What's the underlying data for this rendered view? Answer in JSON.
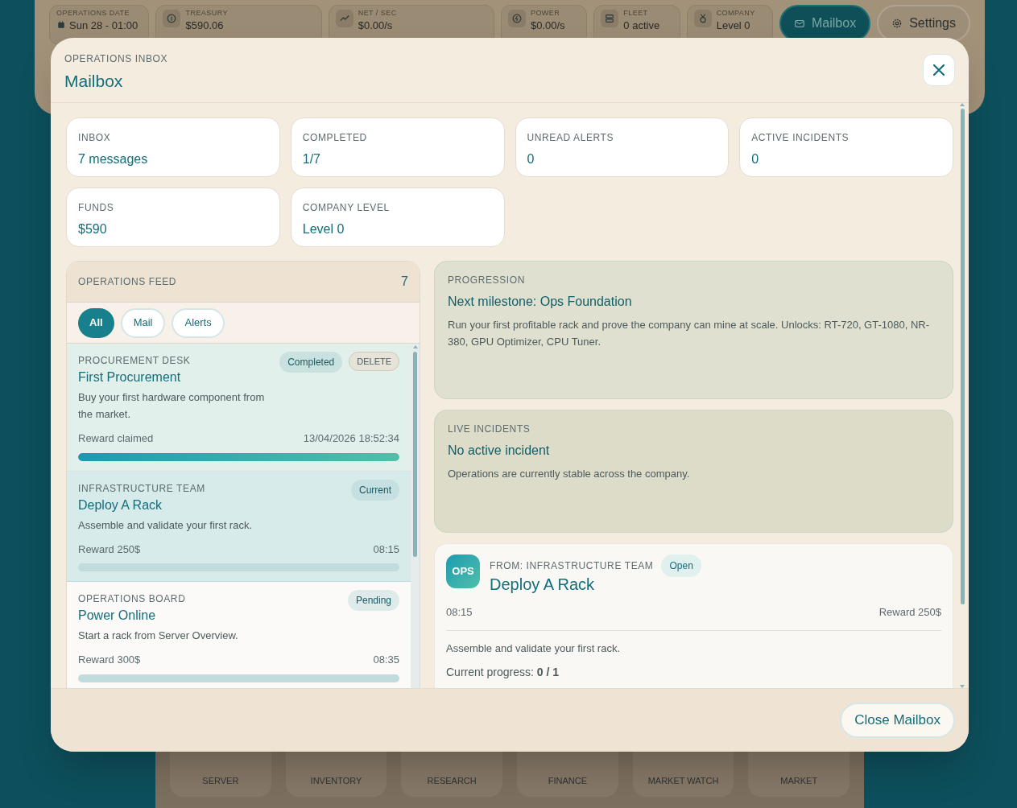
{
  "topbar": {
    "items": [
      {
        "label": "OPERATIONS DATE",
        "value": "Sun 28 - 01:00"
      },
      {
        "label": "TREASURY",
        "value": "$590.06"
      },
      {
        "label": "NET / SEC",
        "value": "$0.00/s"
      },
      {
        "label": "POWER",
        "value": "$0.00/s"
      },
      {
        "label": "FLEET",
        "value": "0 active"
      },
      {
        "label": "COMPANY",
        "value": "Level 0"
      }
    ],
    "buttons": [
      {
        "label": "Mailbox",
        "selected": true
      },
      {
        "label": "Settings",
        "selected": false
      }
    ]
  },
  "bottom_nav": [
    "SERVER",
    "INVENTORY",
    "RESEARCH",
    "FINANCE",
    "MARKET WATCH",
    "MARKET"
  ],
  "modal": {
    "eyebrow": "OPERATIONS INBOX",
    "title": "Mailbox",
    "stats": [
      {
        "label": "INBOX",
        "value": "7 messages"
      },
      {
        "label": "COMPLETED",
        "value": "1/7"
      },
      {
        "label": "UNREAD ALERTS",
        "value": "0"
      },
      {
        "label": "ACTIVE INCIDENTS",
        "value": "0"
      },
      {
        "label": "FUNDS",
        "value": "$590"
      },
      {
        "label": "COMPANY LEVEL",
        "value": "Level 0"
      }
    ],
    "feed": {
      "title": "OPERATIONS FEED",
      "count": "7",
      "filters": [
        {
          "label": "All",
          "selected": true
        },
        {
          "label": "Mail",
          "selected": false
        },
        {
          "label": "Alerts",
          "selected": false
        }
      ],
      "items": [
        {
          "sender": "PROCUREMENT DESK",
          "title": "First Procurement",
          "body": "Buy your first hardware component from the market.",
          "status": "Completed",
          "kind": "completed",
          "delete": "DELETE",
          "footer_left": "Reward claimed",
          "footer_right": "13/04/2026 18:52:34",
          "level": 1,
          "selected": false
        },
        {
          "sender": "INFRASTRUCTURE TEAM",
          "title": "Deploy A Rack",
          "body": "Assemble and validate your first rack.",
          "status": "Current",
          "kind": "current",
          "footer_left": "Reward 250$",
          "footer_right": "08:15",
          "level": 0,
          "selected": true
        },
        {
          "sender": "OPERATIONS BOARD",
          "title": "Power Online",
          "body": "Start a rack from Server Overview.",
          "status": "Pending",
          "kind": "pending",
          "footer_left": "Reward 300$",
          "footer_right": "08:35",
          "level": 0,
          "selected": false
        }
      ]
    },
    "progression": {
      "label": "PROGRESSION",
      "title": "Next milestone: Ops Foundation",
      "body": "Run your first profitable rack and prove the company can mine at scale. Unlocks: RT-720, GT-1080, NR-380, GPU Optimizer, CPU Tuner."
    },
    "incidents": {
      "label": "LIVE INCIDENTS",
      "title": "No active incident",
      "body": "Operations are currently stable across the company."
    },
    "detail": {
      "avatar": "OPS",
      "from": "FROM: INFRASTRUCTURE TEAM",
      "status": "Open",
      "title": "Deploy A Rack",
      "time": "08:15",
      "reward": "Reward 250$",
      "body": "Assemble and validate your first rack.",
      "progress": "Current progress: **0 / 1**"
    },
    "close_button": "Close Mailbox"
  }
}
